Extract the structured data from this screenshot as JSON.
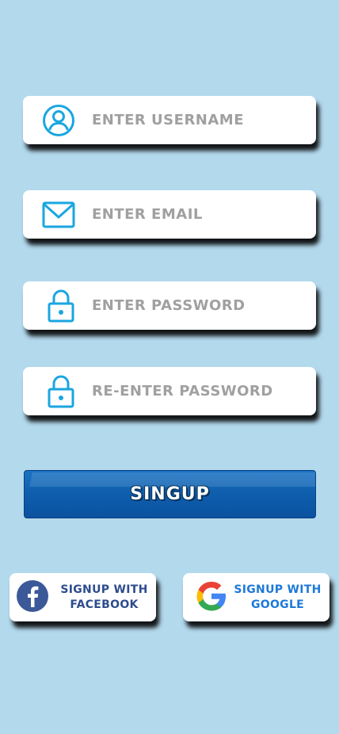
{
  "form": {
    "username": {
      "placeholder": "ENTER USERNAME",
      "icon": "user-circle-icon"
    },
    "email": {
      "placeholder": "ENTER EMAIL",
      "icon": "envelope-icon"
    },
    "password": {
      "placeholder": "ENTER PASSWORD",
      "icon": "lock-icon"
    },
    "confirm_password": {
      "placeholder": "Re-ENTER PASSWORD",
      "icon": "lock-icon"
    }
  },
  "signup_button": {
    "label": "SINGUP"
  },
  "social": {
    "facebook": {
      "line1": "SIGNUP WITH",
      "line2": "FACEBOOK",
      "icon": "facebook-icon"
    },
    "google": {
      "line1": "SIGNUP WITH",
      "line2": "GOOGLE",
      "icon": "google-icon"
    }
  },
  "colors": {
    "background": "#b3d9ed",
    "icon": "#1aa6e0",
    "button": "#0f5fae",
    "facebook": "#2d4c8e",
    "google_text": "#1d79d8"
  }
}
